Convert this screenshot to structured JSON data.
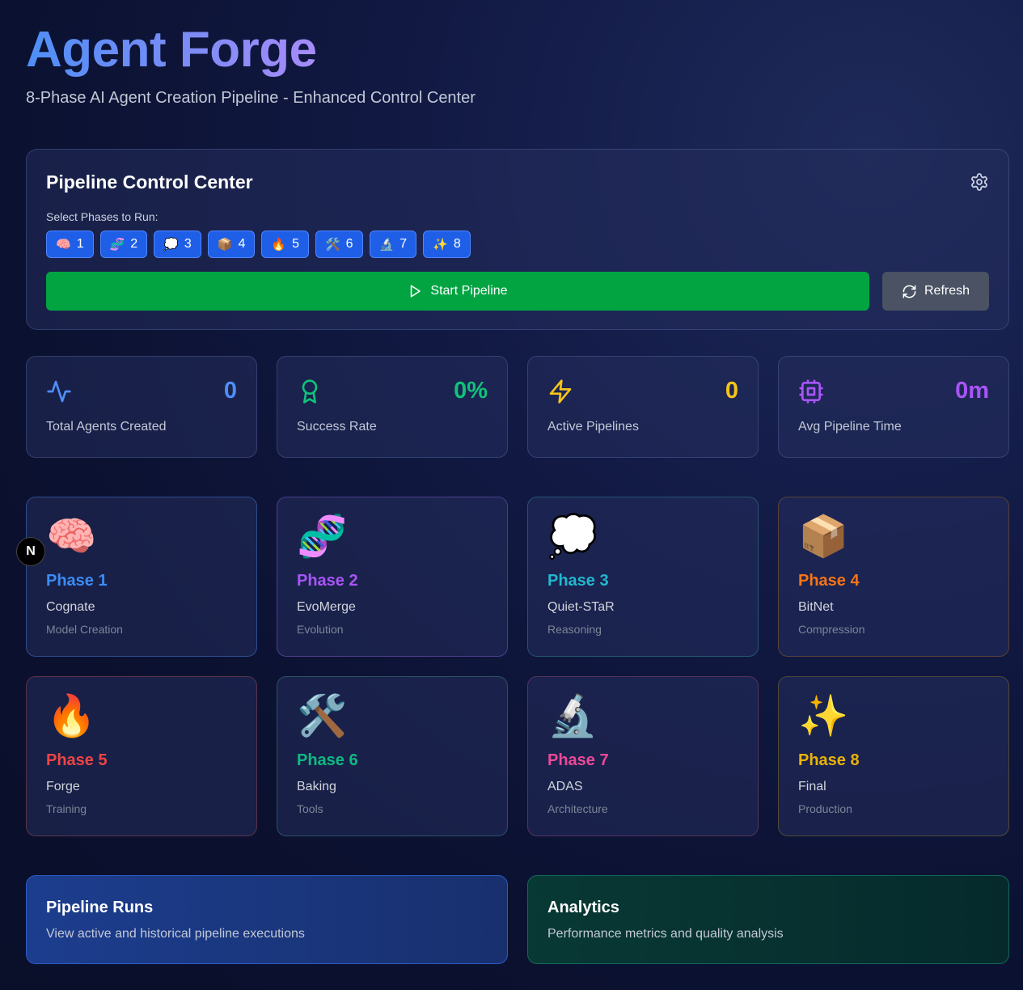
{
  "header": {
    "title": "Agent Forge",
    "subtitle": "8-Phase AI Agent Creation Pipeline - Enhanced Control Center"
  },
  "control": {
    "title": "Pipeline Control Center",
    "select_label": "Select Phases to Run:",
    "chips": [
      {
        "icon": "🧠",
        "label": "1"
      },
      {
        "icon": "🧬",
        "label": "2"
      },
      {
        "icon": "💭",
        "label": "3"
      },
      {
        "icon": "📦",
        "label": "4"
      },
      {
        "icon": "🔥",
        "label": "5"
      },
      {
        "icon": "🛠️",
        "label": "6"
      },
      {
        "icon": "🔬",
        "label": "7"
      },
      {
        "icon": "✨",
        "label": "8"
      }
    ],
    "start_label": "Start Pipeline",
    "refresh_label": "Refresh"
  },
  "stats": [
    {
      "value": "0",
      "label": "Total Agents Created",
      "color": "#4f8ef7",
      "icon": "activity-icon"
    },
    {
      "value": "0%",
      "label": "Success Rate",
      "color": "#10c27a",
      "icon": "award-icon"
    },
    {
      "value": "0",
      "label": "Active Pipelines",
      "color": "#f5c518",
      "icon": "zap-icon"
    },
    {
      "value": "0m",
      "label": "Avg Pipeline Time",
      "color": "#a855f7",
      "icon": "cpu-icon"
    }
  ],
  "phases": [
    {
      "emoji": "🧠",
      "name": "Phase 1",
      "subtitle": "Cognate",
      "category": "Model Creation",
      "color": "#3b8cf5",
      "border": "#2f4c8f"
    },
    {
      "emoji": "🧬",
      "name": "Phase 2",
      "subtitle": "EvoMerge",
      "category": "Evolution",
      "color": "#a855f7",
      "border": "#4a3f8a"
    },
    {
      "emoji": "💭",
      "name": "Phase 3",
      "subtitle": "Quiet-STaR",
      "category": "Reasoning",
      "color": "#22b8cf",
      "border": "#24566f"
    },
    {
      "emoji": "📦",
      "name": "Phase 4",
      "subtitle": "BitNet",
      "category": "Compression",
      "color": "#f97316",
      "border": "#5a4038"
    },
    {
      "emoji": "🔥",
      "name": "Phase 5",
      "subtitle": "Forge",
      "category": "Training",
      "color": "#ef4444",
      "border": "#5a3348"
    },
    {
      "emoji": "🛠️",
      "name": "Phase 6",
      "subtitle": "Baking",
      "category": "Tools",
      "color": "#10b981",
      "border": "#2b5163"
    },
    {
      "emoji": "🔬",
      "name": "Phase 7",
      "subtitle": "ADAS",
      "category": "Architecture",
      "color": "#ec4899",
      "border": "#53345e"
    },
    {
      "emoji": "✨",
      "name": "Phase 8",
      "subtitle": "Final",
      "category": "Production",
      "color": "#eab308",
      "border": "#4e4a3a"
    }
  ],
  "bottom": {
    "runs": {
      "title": "Pipeline Runs",
      "description": "View active and historical pipeline executions"
    },
    "analytics": {
      "title": "Analytics",
      "description": "Performance metrics and quality analysis"
    }
  },
  "badge": {
    "label": "N"
  }
}
